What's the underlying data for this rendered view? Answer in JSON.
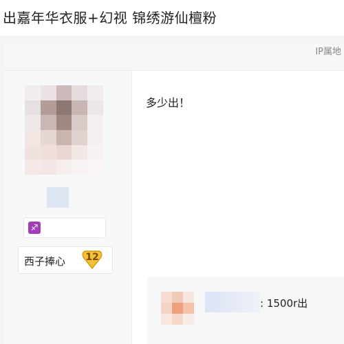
{
  "thread": {
    "title": "出嘉年华衣服+幻视 锦绣游仙檀粉",
    "ip_label": "IP属地"
  },
  "author": {
    "badge_icon": "zodiac-badge-icon",
    "level_name": "西子捧心",
    "level": "12",
    "badge_color": "#a23fb6",
    "level_color": "#f3c23a"
  },
  "post": {
    "text": "多少出！"
  },
  "reply": {
    "text": ": 1500r出"
  }
}
